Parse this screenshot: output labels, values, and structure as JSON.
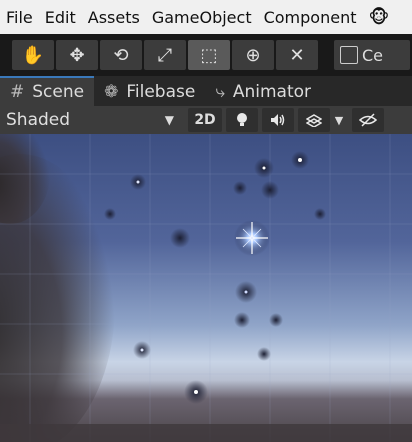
{
  "menu": {
    "items": [
      "File",
      "Edit",
      "Assets",
      "GameObject",
      "Component"
    ],
    "account_icon": "monkey-icon"
  },
  "toolbar": {
    "tools": [
      {
        "name": "hand-tool",
        "icon": "hand-icon",
        "glyph": "✋"
      },
      {
        "name": "move-tool",
        "icon": "move-icon",
        "glyph": "✥"
      },
      {
        "name": "rotate-tool",
        "icon": "rotate-icon",
        "glyph": "⟲"
      },
      {
        "name": "scale-tool",
        "icon": "scale-icon",
        "glyph": "⤢"
      },
      {
        "name": "rect-tool",
        "icon": "rect-icon",
        "glyph": "⬚"
      },
      {
        "name": "transform-tool",
        "icon": "transform-icon",
        "glyph": "⊕"
      },
      {
        "name": "custom-tool",
        "icon": "tools-icon",
        "glyph": "✕"
      }
    ],
    "active_tool": "rect-tool",
    "pivot_label": "Ce"
  },
  "tabs": [
    {
      "label": "Scene",
      "icon": "grid-icon",
      "glyph": "#"
    },
    {
      "label": "Filebase",
      "icon": "filebase-icon",
      "glyph": "❁"
    },
    {
      "label": "Animator",
      "icon": "animator-icon",
      "glyph": "⤷"
    }
  ],
  "scene_toolbar": {
    "draw_mode": "Shaded",
    "mode_2d": "2D",
    "icons": [
      "light-icon",
      "audio-icon",
      "effects-icon",
      "dropdown-icon",
      "visibility-icon"
    ]
  },
  "colors": {
    "accent": "#3a79bb",
    "toolbar_bg": "#191919",
    "menubar_bg": "#f0f0f0"
  }
}
